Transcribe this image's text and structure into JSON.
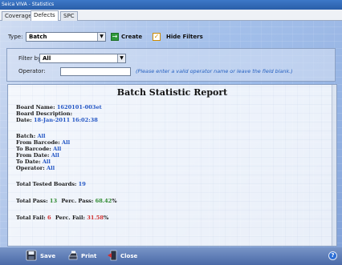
{
  "window": {
    "title": "Seica VIVA - Statistics"
  },
  "tabs": [
    {
      "label": "Coverage"
    },
    {
      "label": "Defects"
    },
    {
      "label": "SPC"
    }
  ],
  "toolbar": {
    "type_label": "Type:",
    "type_value": "Batch",
    "create_label": "Create",
    "hide_filters_label": "Hide Filters"
  },
  "filters": {
    "filter_by_label": "Filter by:",
    "filter_by_value": "All",
    "operator_label": "Operator:",
    "operator_value": "",
    "operator_hint": "(Please enter a valid operator name or leave the field blank.)"
  },
  "report": {
    "title": "Batch Statistic Report",
    "board_name_label": "Board Name:",
    "board_name_value": "1620101-003et",
    "board_description_label": "Board Description:",
    "date_label": "Date:",
    "date_value": "18-Jan-2011 16:02:38",
    "batch_label": "Batch:",
    "batch_value": "All",
    "from_barcode_label": "From Barcode:",
    "from_barcode_value": "All",
    "to_barcode_label": "To Barcode:",
    "to_barcode_value": "All",
    "from_date_label": "From Date:",
    "from_date_value": "All",
    "to_date_label": "To Date:",
    "to_date_value": "All",
    "operator_label": "Operator:",
    "operator_value": "All",
    "total_tested_label": "Total Tested Boards:",
    "total_tested_value": "19",
    "total_pass_label": "Total Pass:",
    "total_pass_value": "13",
    "perc_pass_label": "Perc. Pass:",
    "perc_pass_value": "68.42",
    "total_fail_label": "Total Fail:",
    "total_fail_value": "6",
    "perc_fail_label": "Perc. Fail:",
    "perc_fail_value": "31.58",
    "percent_sign": "%"
  },
  "bottom": {
    "save_label": "Save",
    "print_label": "Print",
    "close_label": "Close",
    "help_symbol": "?"
  },
  "icons": {
    "create": "create-icon",
    "hide_filters": "checkbox-icon",
    "save": "save-icon",
    "print": "print-icon",
    "close": "close-icon",
    "help": "help-icon",
    "dropdown": "chevron-down-icon"
  },
  "colors": {
    "title_bar": "#2a5ea8",
    "value_blue": "#2255c4",
    "pass_green": "#2f8a2f",
    "fail_red": "#d03030",
    "hint_blue": "#2560c0",
    "bottom_bar": "#4b6aa8"
  }
}
